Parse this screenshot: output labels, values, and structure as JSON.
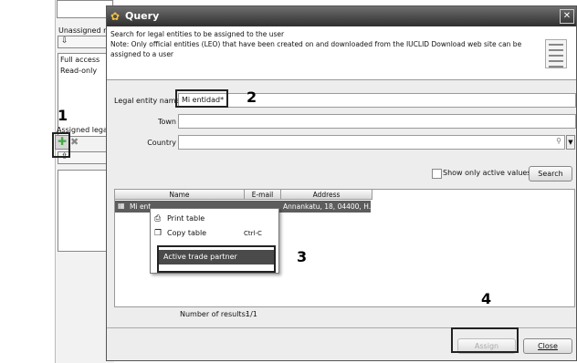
{
  "background": {
    "unassigned_label": "Unassigned r",
    "roles": [
      "Full access",
      "Read-only"
    ],
    "assigned_label": "Assigned lega"
  },
  "dialog": {
    "title": "Query",
    "info_line1": "Search for legal entities to be assigned to the user",
    "info_line2": "Note: Only official entities (LEO) that have been created on and downloaded from the IUCLID Download web site can be",
    "info_line3": "assigned to a user",
    "legal_entity_label": "Legal entity name",
    "legal_entity_value": "Mi entidad*",
    "town_label": "Town",
    "town_value": "",
    "country_label": "Country",
    "country_value": "",
    "active_checkbox_label": "Show only active values",
    "active_checked": false,
    "search_button": "Search",
    "columns": [
      "Name",
      "E-mail",
      "Address"
    ],
    "row": {
      "name": "Mi ent",
      "address": "Annankatu, 18, 04400, H..."
    },
    "results_label": "Number of results:",
    "results_value": "1/1",
    "assign_button": "Assign",
    "close_button": "Close"
  },
  "context_menu": {
    "items": [
      {
        "label": "Print table",
        "shortcut": ""
      },
      {
        "label": "Copy table",
        "shortcut": "Ctrl-C"
      },
      {
        "label": "Active trade partner",
        "shortcut": ""
      }
    ]
  },
  "callouts": [
    "1",
    "2",
    "3",
    "4"
  ]
}
